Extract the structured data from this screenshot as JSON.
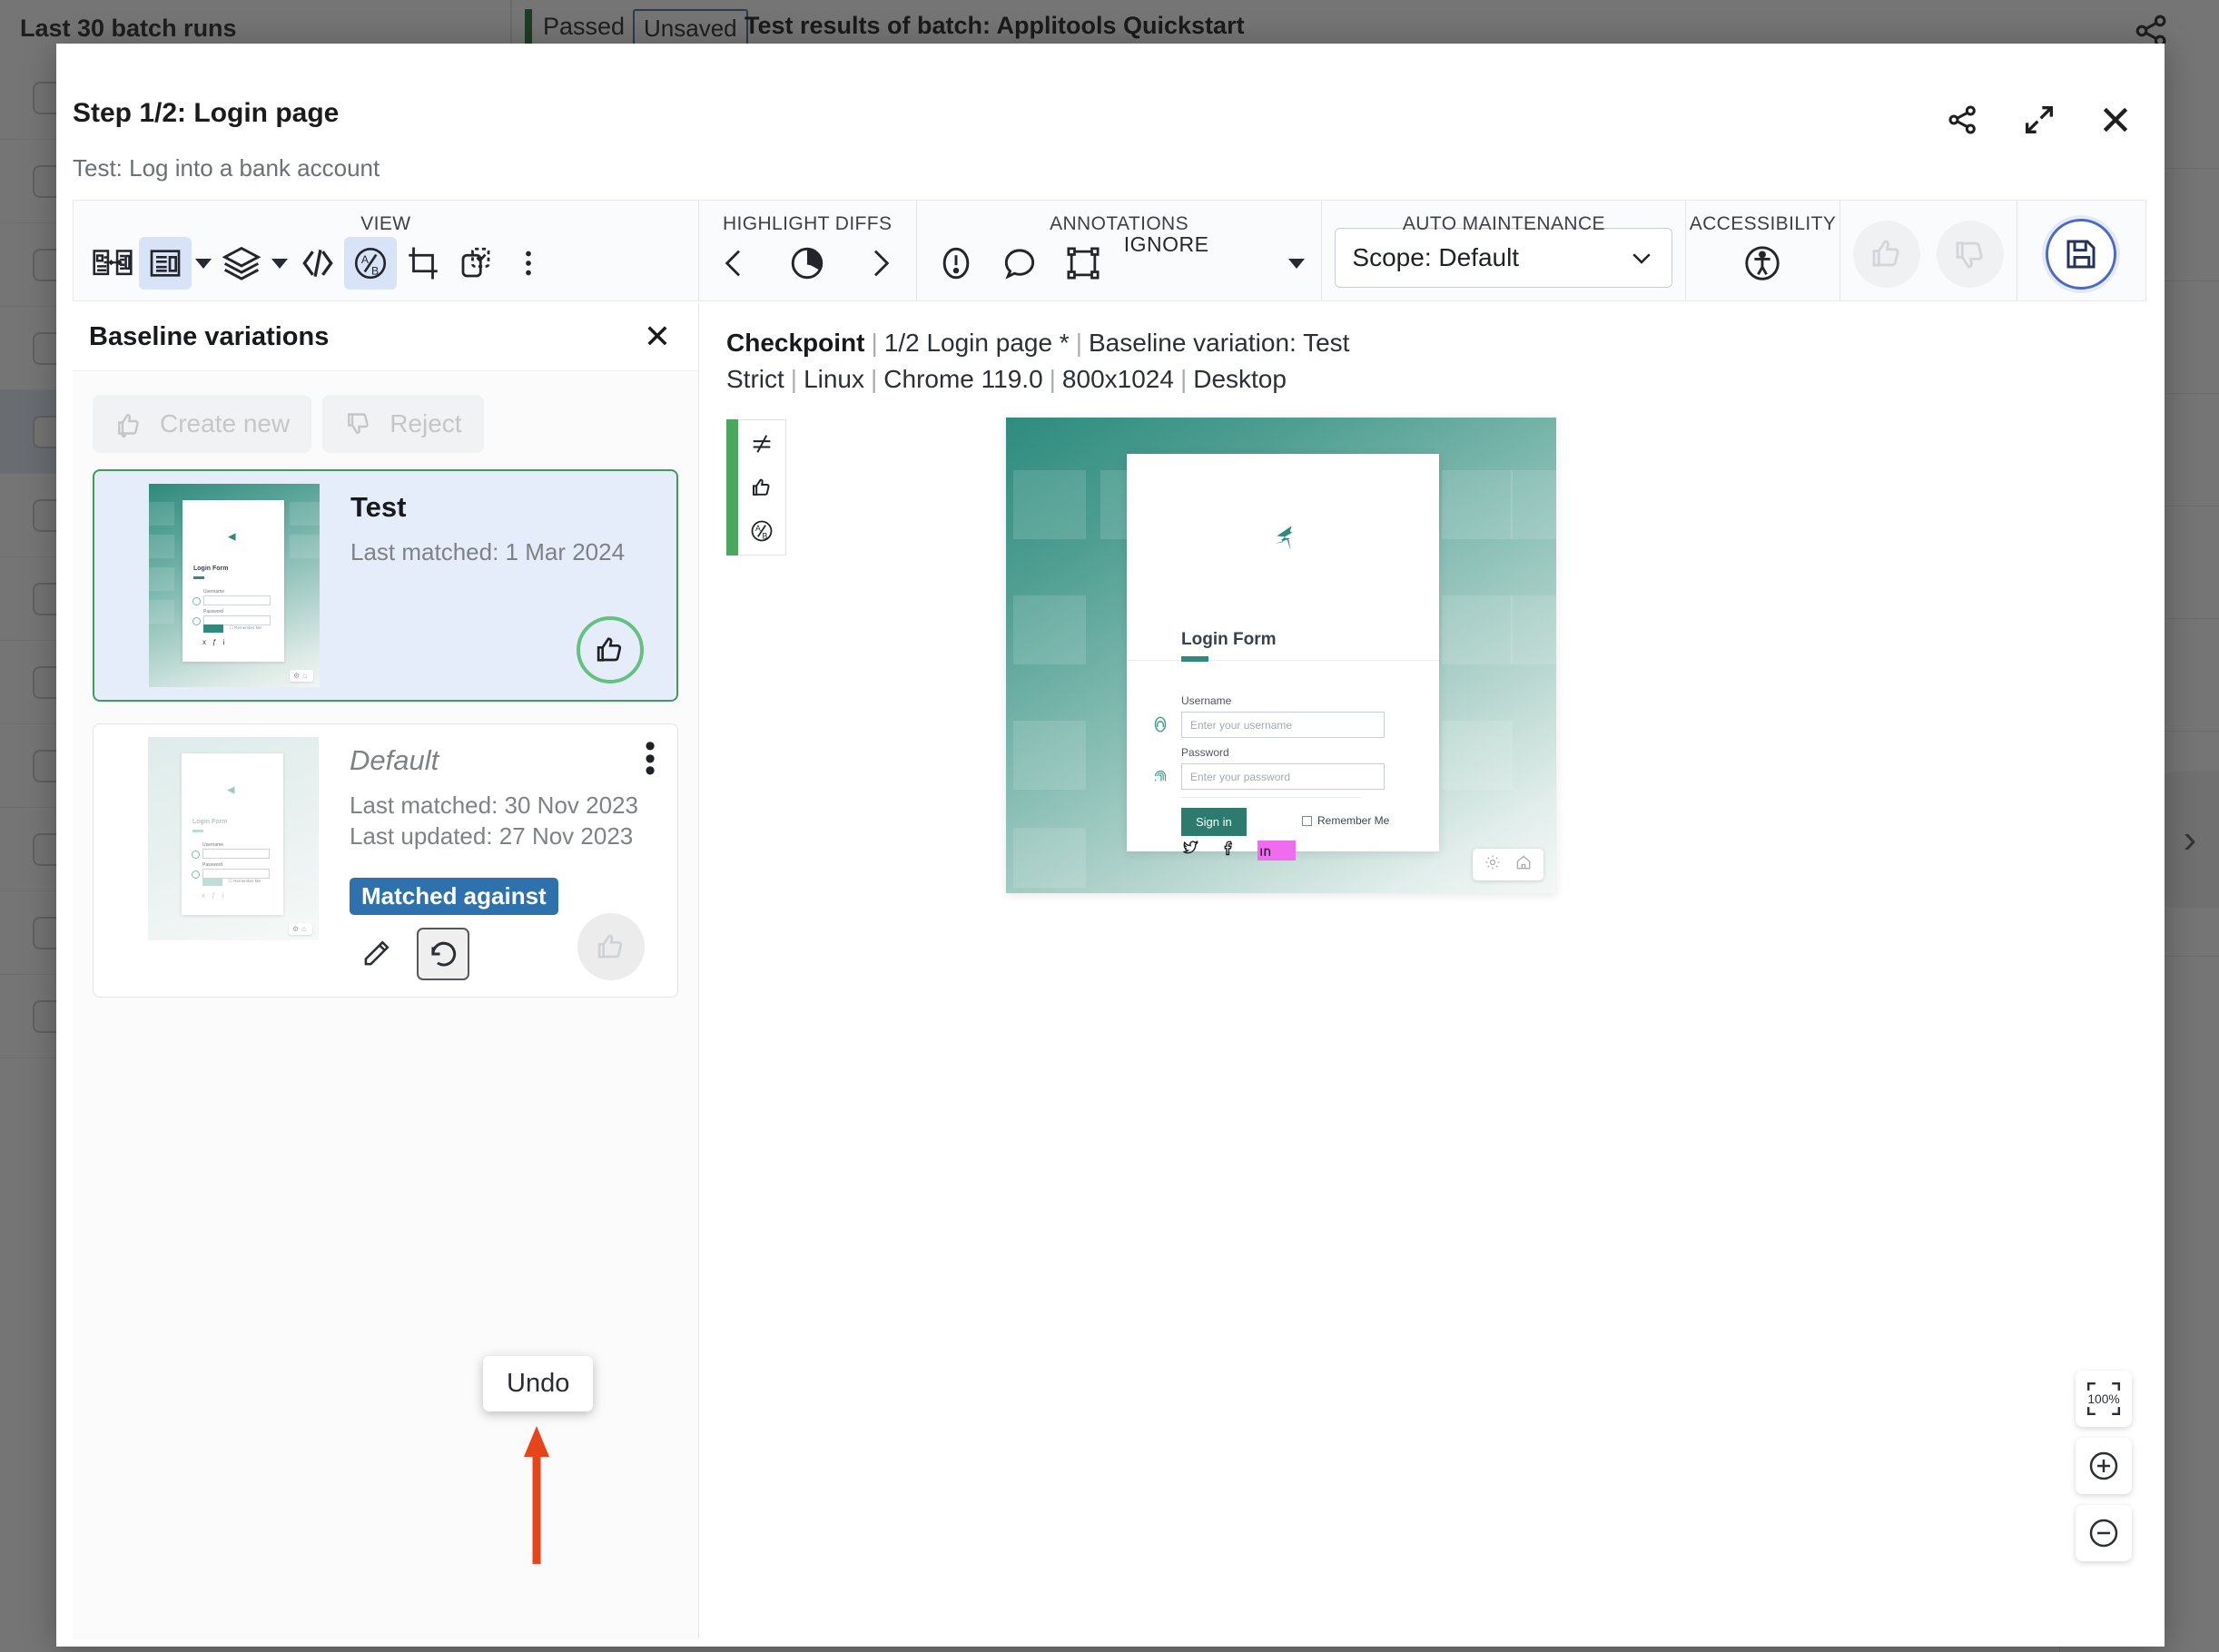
{
  "background": {
    "page_title": "Last 30 batch runs",
    "status": "Passed",
    "saved_state": "Unsaved",
    "batch_title": "Test results of batch:  Applitools Quickstart"
  },
  "modal": {
    "title": "Step 1/2:  Login page",
    "subtitle": "Test: Log into a bank account",
    "actions": {
      "share": "share-icon",
      "expand": "expand-icon",
      "close": "close-icon"
    }
  },
  "toolbar": {
    "groups": {
      "view": {
        "label": "VIEW",
        "buttons": [
          {
            "name": "side-by-side-icon",
            "active": false
          },
          {
            "name": "single-view-icon",
            "active": true
          },
          {
            "name": "layers-icon",
            "active": false
          },
          {
            "name": "code-icon",
            "active": false
          },
          {
            "name": "ab-compare-icon",
            "active": true
          },
          {
            "name": "crop-icon",
            "active": false
          },
          {
            "name": "region-select-icon",
            "active": false
          },
          {
            "name": "more-options-icon",
            "active": false
          }
        ]
      },
      "highlight_diffs": {
        "label": "HIGHLIGHT DIFFS",
        "prev": "prev-diff-icon",
        "toggle": "diff-highlight-icon",
        "next": "next-diff-icon"
      },
      "annotations": {
        "label": "ANNOTATIONS",
        "issue": "issue-icon",
        "comment": "comment-icon",
        "region": "ignore-region-icon",
        "region_label": "IGNORE"
      },
      "auto_maintenance": {
        "label": "AUTO MAINTENANCE",
        "scope_value": "Scope: Default"
      },
      "accessibility": {
        "label": "ACCESSIBILITY",
        "icon": "accessibility-icon"
      },
      "verdict": {
        "thumbs_up": "thumbs-up-icon",
        "thumbs_down": "thumbs-down-icon",
        "save": "save-icon"
      }
    }
  },
  "side_panel": {
    "title": "Baseline variations",
    "close": "close-icon",
    "actions": [
      {
        "name": "create-new-button",
        "label": "Create new",
        "icon": "thumbs-up-plus-icon"
      },
      {
        "name": "reject-button",
        "label": "Reject",
        "icon": "thumbs-down-icon"
      }
    ],
    "variations": [
      {
        "name": "Test",
        "italic": false,
        "selected": true,
        "last_matched": "Last matched: 1 Mar 2024",
        "last_updated": "",
        "badge": "",
        "approve_state": "approved"
      },
      {
        "name": "Default",
        "italic": true,
        "selected": false,
        "last_matched": "Last matched: 30 Nov 2023",
        "last_updated": "Last updated: 27 Nov 2023",
        "badge": "Matched against",
        "approve_state": "disabled",
        "controls": [
          {
            "name": "edit-icon"
          },
          {
            "name": "undo-icon"
          }
        ]
      }
    ],
    "tooltip": "Undo"
  },
  "viewer": {
    "breadcrumb": {
      "label": "Checkpoint",
      "step": "1/2 Login page *",
      "variation": "Baseline variation: Test",
      "match_level": "Strict",
      "os": "Linux",
      "browser": "Chrome 119.0",
      "viewport": "800x1024",
      "device": "Desktop"
    },
    "status_strip": [
      {
        "name": "diff-not-equal-icon"
      },
      {
        "name": "thumbs-up-icon"
      },
      {
        "name": "ab-compare-icon"
      }
    ],
    "screenshot": {
      "login_form": {
        "logo": "applitools-logo-icon",
        "title": "Login Form",
        "username_label": "Username",
        "username_placeholder": "Enter your username",
        "password_label": "Password",
        "password_placeholder": "Enter your password",
        "signin_label": "Sign in",
        "remember_label": "Remember Me",
        "social": [
          "twitter-icon",
          "facebook-icon",
          "linkedin-icon"
        ]
      },
      "footer_icons": [
        "gear-icon",
        "home-icon"
      ]
    },
    "zoom_controls": [
      {
        "name": "zoom-fit-button",
        "label": "100%"
      },
      {
        "name": "zoom-in-button",
        "label": "+"
      },
      {
        "name": "zoom-out-button",
        "label": "−"
      }
    ]
  },
  "colors": {
    "accent_blue": "#4a6bc4",
    "approve_green": "#64c17f",
    "status_green": "#4aa75e",
    "badge_blue": "#2e72ad",
    "teal": "#2d8a7c",
    "annotation_red": "#e8441c"
  }
}
